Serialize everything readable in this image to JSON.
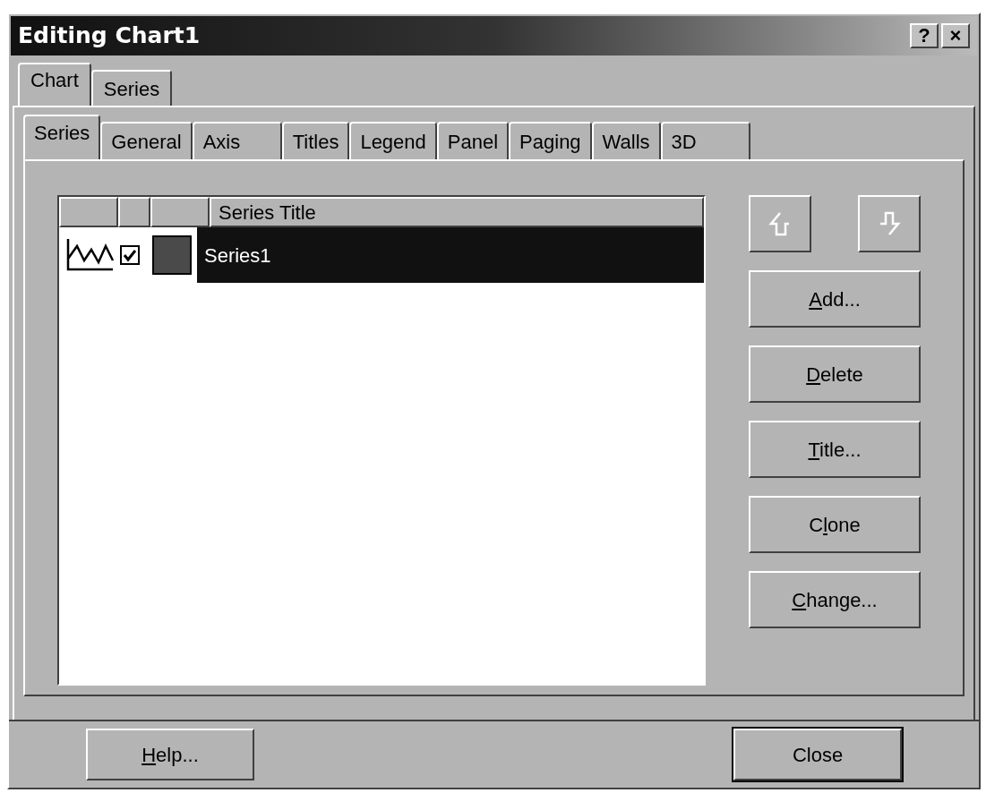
{
  "window": {
    "title": "Editing Chart1",
    "title_buttons": [
      "?",
      "×"
    ]
  },
  "outer_tabs": [
    {
      "label": "Chart",
      "selected": true
    },
    {
      "label": "Series",
      "selected": false
    }
  ],
  "inner_tabs": [
    {
      "label": "Series",
      "selected": true
    },
    {
      "label": "General",
      "selected": false
    },
    {
      "label": "Axis",
      "selected": false
    },
    {
      "label": "Titles",
      "selected": false
    },
    {
      "label": "Legend",
      "selected": false
    },
    {
      "label": "Panel",
      "selected": false
    },
    {
      "label": "Paging",
      "selected": false
    },
    {
      "label": "Walls",
      "selected": false
    },
    {
      "label": "3D",
      "selected": false
    }
  ],
  "series_list": {
    "columns": [
      "",
      "",
      "",
      "Series Title"
    ],
    "rows": [
      {
        "title": "Series1",
        "active": true,
        "selected": true,
        "color": "#4a4a4a"
      }
    ]
  },
  "side_buttons": [
    {
      "parts": [
        {
          "text": "A",
          "underlined": true
        },
        {
          "text": "dd...",
          "underlined": false
        }
      ]
    },
    {
      "parts": [
        {
          "text": "D",
          "underlined": true
        },
        {
          "text": "elete",
          "underlined": false
        }
      ]
    },
    {
      "parts": [
        {
          "text": "T",
          "underlined": true
        },
        {
          "text": "itle...",
          "underlined": false
        }
      ]
    },
    {
      "parts": [
        {
          "text": "C",
          "underlined": false
        },
        {
          "text": "l",
          "underlined": true
        },
        {
          "text": "one",
          "underlined": false
        }
      ]
    },
    {
      "parts": [
        {
          "text": "C",
          "underlined": true
        },
        {
          "text": "hange...",
          "underlined": false
        }
      ]
    }
  ],
  "footer_buttons": [
    {
      "parts": [
        {
          "text": "H",
          "underlined": true
        },
        {
          "text": "elp...",
          "underlined": false
        }
      ],
      "default": false
    },
    {
      "parts": [
        {
          "text": "Close",
          "underlined": false
        }
      ],
      "default": true
    }
  ]
}
